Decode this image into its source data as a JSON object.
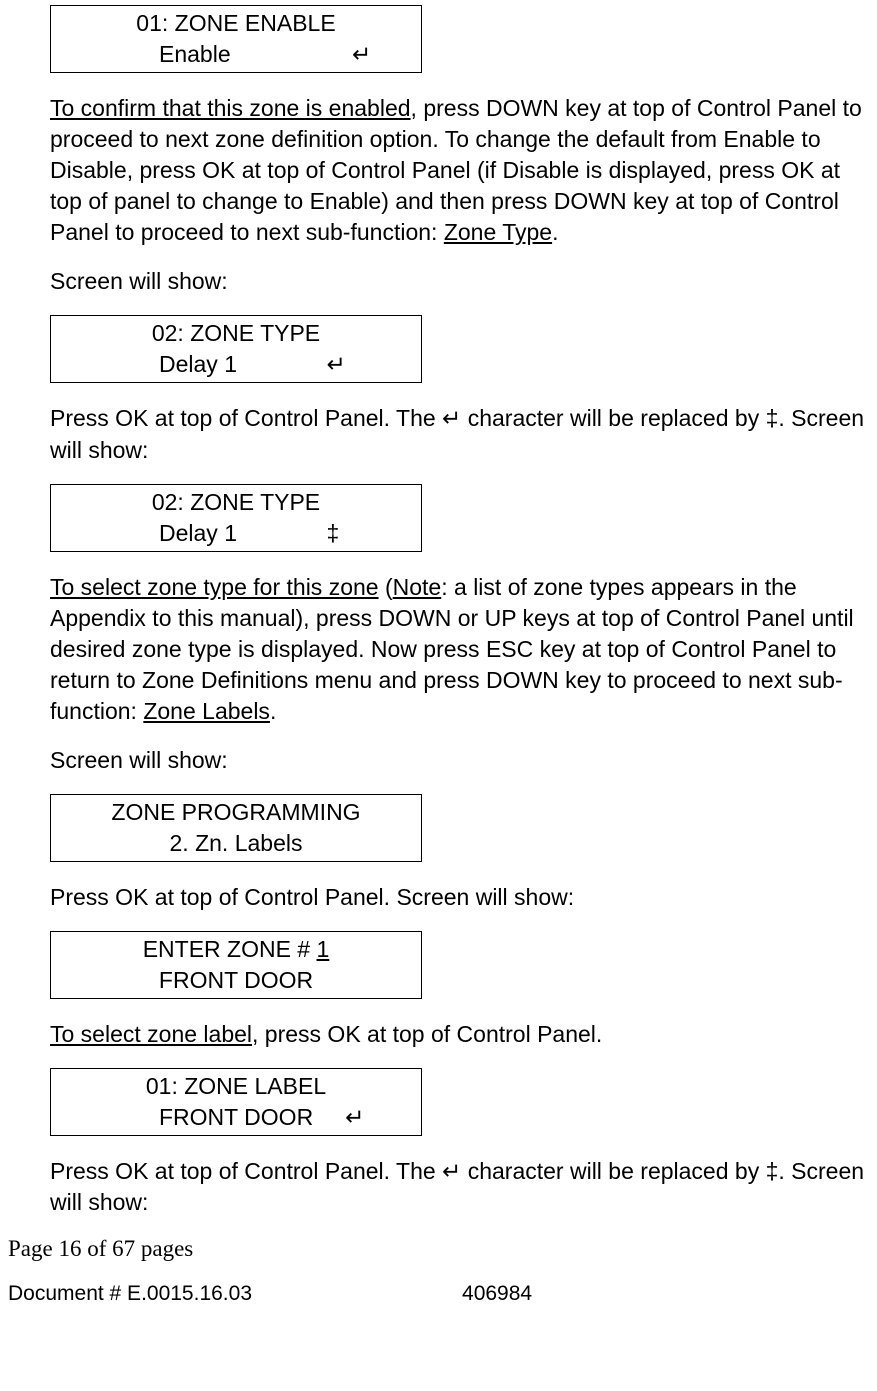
{
  "screens": {
    "s1": {
      "line1": "01: ZONE ENABLE",
      "line2": "Enable                   ↵"
    },
    "s2": {
      "line1": "02: ZONE TYPE",
      "line2": "Delay 1              ↵"
    },
    "s3": {
      "line1": "02: ZONE TYPE",
      "line2": "Delay 1              ‡"
    },
    "s4": {
      "line1": "ZONE PROGRAMMING",
      "line2": "2. Zn. Labels"
    },
    "s5": {
      "line1_a": "ENTER ZONE # ",
      "line1_b": "1",
      "line2": "FRONT DOOR"
    },
    "s6": {
      "line1": "01: ZONE LABEL",
      "line2": "FRONT DOOR     ↵"
    }
  },
  "para": {
    "p1_u": "To confirm that this zone is enabled",
    "p1_a": ", press DOWN key at top of Control Panel to proceed to next zone definition option. To change the default from Enable to Disable, press OK at top of Control Panel (if Disable is displayed, press OK at top of panel to change to Enable) and then press DOWN key at top of Control Panel to proceed to next sub-function: ",
    "p1_b": "Zone Type",
    "p1_c": ".",
    "p2": "Screen will show:",
    "p3": "Press OK at top of Control Panel. The ↵ character will be replaced by ‡. Screen will show:",
    "p4_u1": "To select zone type for this zone",
    "p4_a": " (",
    "p4_u2": "Note",
    "p4_b": ": a list of zone types appears in the Appendix to this manual), press DOWN or UP keys at top of Control Panel until desired zone type is displayed. Now press ESC key at top of Control Panel to return to Zone Definitions menu and press DOWN key to proceed to next sub-function: ",
    "p4_u3": "Zone Labels",
    "p4_c": ".",
    "p5": "Screen will show:",
    "p6": "Press OK at top of Control Panel. Screen will show:",
    "p7_u": "To select zone label",
    "p7_a": ", press OK at top of Control Panel.",
    "p8": "Press OK at top of Control Panel. The ↵ character will be replaced by ‡. Screen will show:"
  },
  "footer": {
    "pageinfo": "Page 16 of  67 pages",
    "docnum": "Document # E.0015.16.03",
    "idnum": "406984"
  }
}
